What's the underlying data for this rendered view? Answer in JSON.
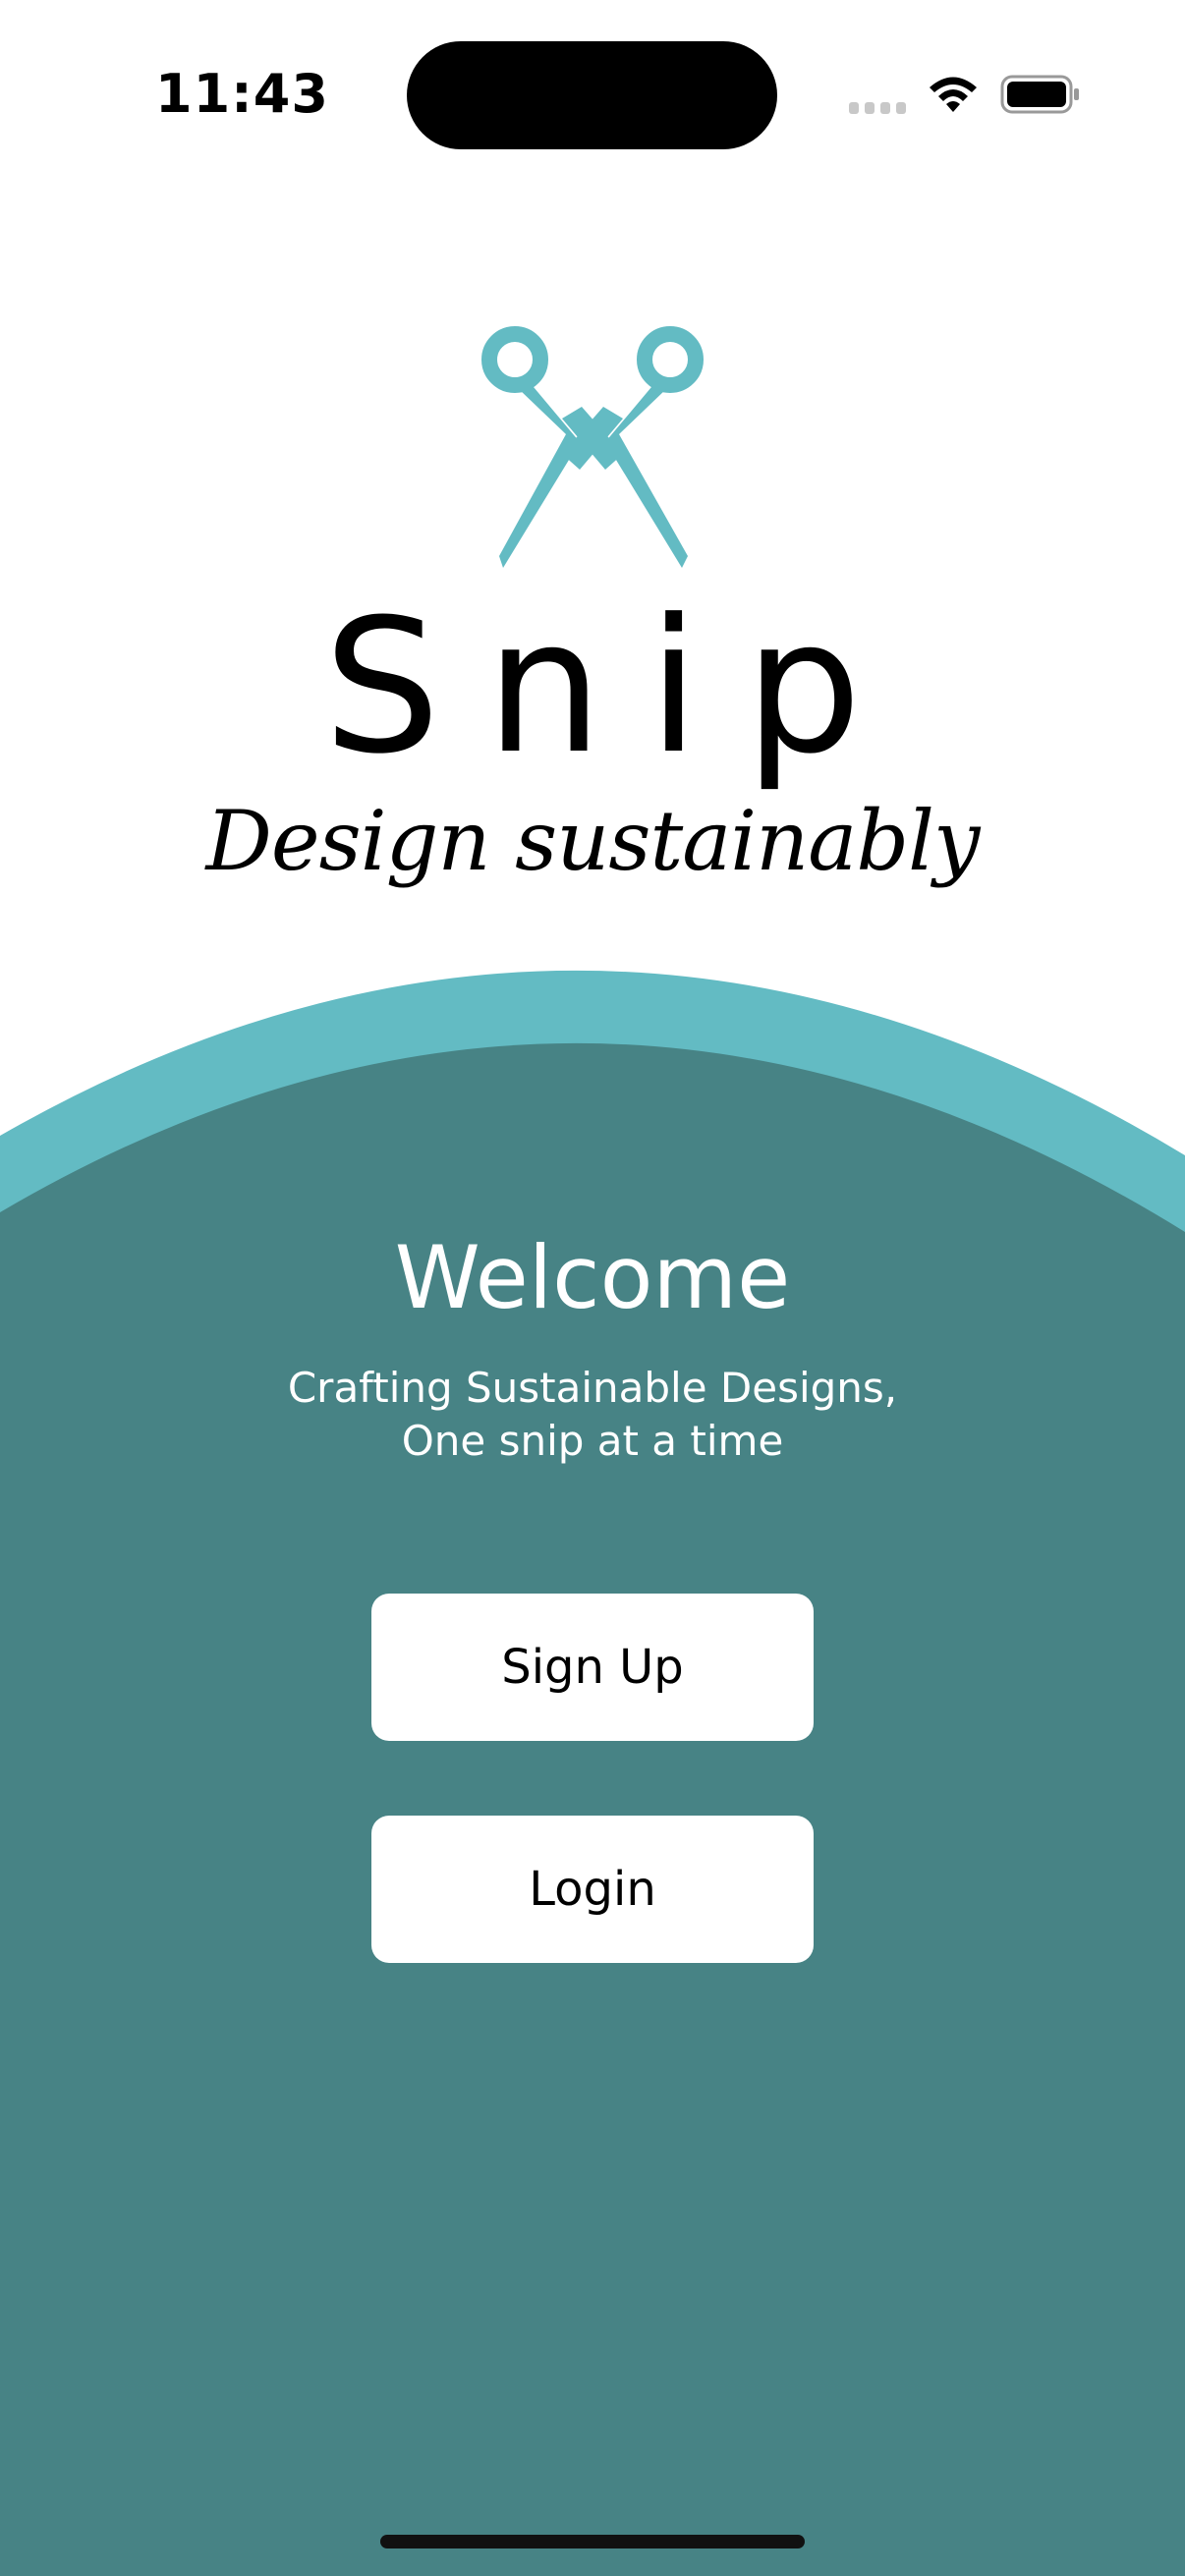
{
  "status_bar": {
    "time": "11:43",
    "icons": [
      "cellular-signal-icon",
      "wifi-icon",
      "battery-icon"
    ]
  },
  "logo": {
    "icon": "scissors-icon",
    "app_name": "Snip",
    "tagline": "Design sustainably"
  },
  "welcome": {
    "title": "Welcome",
    "subtitle_line1": "Crafting Sustainable Designs,",
    "subtitle_line2": "One snip at a time"
  },
  "buttons": {
    "signup": "Sign Up",
    "login": "Login"
  },
  "colors": {
    "accent_light": "#63BBC3",
    "panel": "#478385",
    "background": "#FFFFFF",
    "button_bg": "#FFFFFF"
  }
}
